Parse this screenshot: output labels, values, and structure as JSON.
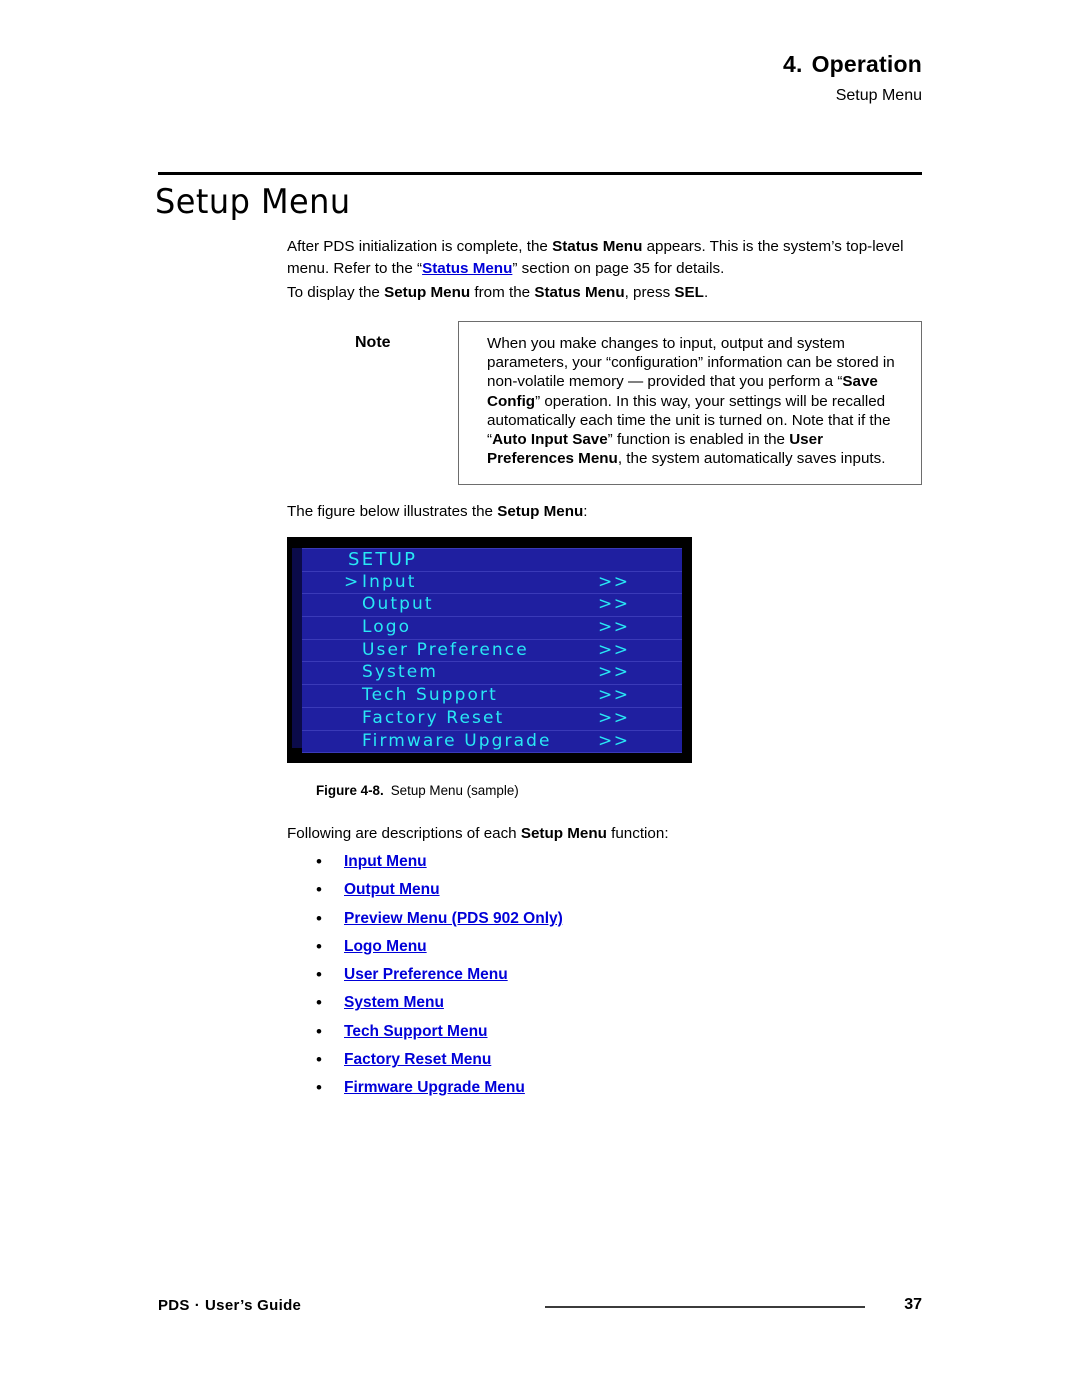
{
  "header": {
    "chapter_number": "4.",
    "chapter_title": "Operation",
    "subtitle": "Setup Menu"
  },
  "section": {
    "title": "Setup Menu"
  },
  "intro": {
    "para1_a": "After PDS initialization is complete, the ",
    "para1_bold1": "Status Menu",
    "para1_b": " appears.  This is the system’s top-level menu.  Refer to the “",
    "para1_link": "Status Menu",
    "para1_c": "” section on page 35 for details.",
    "para2_a": "To display the ",
    "para2_bold1": "Setup Menu",
    "para2_b": " from the ",
    "para2_bold2": "Status Menu",
    "para2_c": ", press ",
    "para2_bold3": "SEL",
    "para2_d": "."
  },
  "note": {
    "label": "Note",
    "t1": "When you make changes to input, output and system parameters, your “configuration” information can be stored in non-volatile memory — provided that you perform a “",
    "b1": "Save Config",
    "t2": "” operation.  In this way, your settings will be recalled automatically each time the unit is turned on.  Note that if the “",
    "b2": "Auto Input Save",
    "t3": "” function is enabled in the ",
    "b3": "User Preferences Menu",
    "t4": ", the system automatically saves inputs."
  },
  "figure_intro": {
    "a": "The figure below illustrates the ",
    "bold": "Setup Menu",
    "b": ":"
  },
  "osd": {
    "title": "SETUP",
    "cursor": ">",
    "arrows": ">>",
    "colors": {
      "background": "#000000",
      "row": "#1f1fa0",
      "text": "#29e8f5",
      "separator": "#3a3ab8",
      "left_strip": "#0b0b4a"
    },
    "rows": [
      {
        "label": "Input",
        "selected": true,
        "arrows": ">>"
      },
      {
        "label": "Output",
        "selected": false,
        "arrows": ">>"
      },
      {
        "label": "Logo",
        "selected": false,
        "arrows": ">>"
      },
      {
        "label": "User Preference",
        "selected": false,
        "arrows": ">>"
      },
      {
        "label": "System",
        "selected": false,
        "arrows": ">>"
      },
      {
        "label": "Tech Support",
        "selected": false,
        "arrows": ">>"
      },
      {
        "label": "Factory Reset",
        "selected": false,
        "arrows": ">>"
      },
      {
        "label": "Firmware Upgrade",
        "selected": false,
        "arrows": ">>"
      }
    ]
  },
  "figure_caption": {
    "number": "Figure 4-8.",
    "text": "Setup Menu  (sample)"
  },
  "desc_intro": {
    "a": "Following are descriptions of each ",
    "bold": "Setup Menu",
    "b": " function:"
  },
  "menu_links": {
    "bullet": "•",
    "items": [
      {
        "label": "Input Menu"
      },
      {
        "label": "Output Menu"
      },
      {
        "label": "Preview Menu (PDS 902 Only)"
      },
      {
        "label": "Logo Menu"
      },
      {
        "label": "User Preference Menu"
      },
      {
        "label": "System Menu"
      },
      {
        "label": "Tech Support Menu"
      },
      {
        "label": "Factory Reset Menu"
      },
      {
        "label": "Firmware Upgrade Menu"
      }
    ],
    "link_color": "#0000d8"
  },
  "footer": {
    "product": "PDS",
    "separator": "·",
    "guide": "User’s Guide",
    "page_number": "37"
  }
}
